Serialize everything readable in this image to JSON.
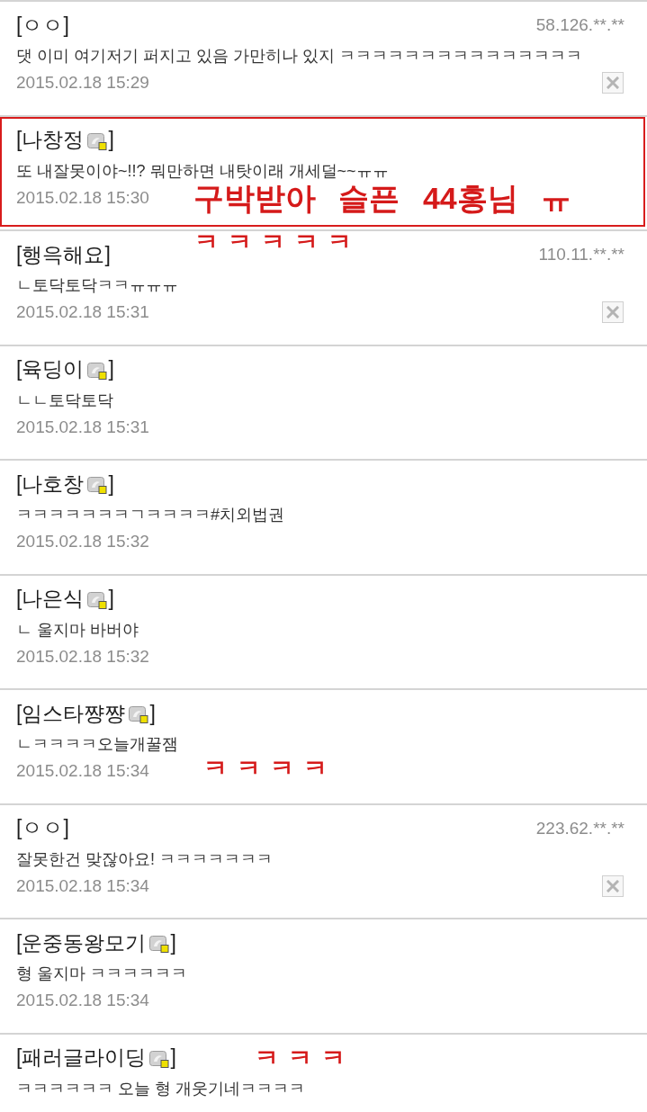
{
  "comments": [
    {
      "open": "[",
      "name": "ㅇㅇ",
      "close": "]",
      "member_icon": false,
      "ip": "58.126.**.**",
      "text": "댓 이미 여기저기 퍼지고 있음 가만히나 있지 ㅋㅋㅋㅋㅋㅋㅋㅋㅋㅋㅋㅋㅋㅋㅋ",
      "date": "2015.02.18 15:29",
      "deletable": true,
      "highlighted": false
    },
    {
      "open": "[",
      "name": "나창정",
      "close": "]",
      "member_icon": true,
      "text": "또 내잘못이야~!!? 뭐만하면 내탓이래 개세덜~~ㅠㅠ",
      "date": "2015.02.18 15:30",
      "deletable": false,
      "highlighted": true
    },
    {
      "open": "[",
      "name": "행윽해요",
      "close": "]",
      "member_icon": false,
      "ip": "110.11.**.**",
      "text": "ㄴ토닥토닥ㅋㅋㅠㅠㅠ",
      "date": "2015.02.18 15:31",
      "deletable": true,
      "highlighted": false
    },
    {
      "open": "[",
      "name": "육딩이",
      "close": "]",
      "member_icon": true,
      "text": "ㄴㄴ토닥토닥",
      "date": "2015.02.18 15:31",
      "deletable": false,
      "highlighted": false
    },
    {
      "open": "[",
      "name": "나호창",
      "close": "]",
      "member_icon": true,
      "text": "ㅋㅋㅋㅋㅋㅋㅋㄱㅋㅋㅋㅋ#치외법권",
      "date": "2015.02.18 15:32",
      "deletable": false,
      "highlighted": false
    },
    {
      "open": "[",
      "name": "나은식",
      "close": "]",
      "member_icon": true,
      "text": "ㄴ 울지마 바버야",
      "date": "2015.02.18 15:32",
      "deletable": false,
      "highlighted": false
    },
    {
      "open": "[",
      "name": "임스타쨩쨩",
      "close": "]",
      "member_icon": true,
      "text": "ㄴㅋㅋㅋㅋ오늘개꿀잼",
      "date": "2015.02.18 15:34",
      "deletable": false,
      "highlighted": false
    },
    {
      "open": "[",
      "name": "ㅇㅇ",
      "close": "]",
      "member_icon": false,
      "ip": "223.62.**.**",
      "text": "잘못한건 맞잖아요! ㅋㅋㅋㅋㅋㅋㅋ",
      "date": "2015.02.18 15:34",
      "deletable": true,
      "highlighted": false
    },
    {
      "open": "[",
      "name": "운중동왕모기",
      "close": "]",
      "member_icon": true,
      "text": "형 울지마 ㅋㅋㅋㅋㅋㅋ",
      "date": "2015.02.18 15:34",
      "deletable": false,
      "highlighted": false
    },
    {
      "open": "[",
      "name": "패러글라이딩",
      "close": "]",
      "member_icon": true,
      "text": "ㅋㅋㅋㅋㅋㅋ 오늘 형 개웃기네ㅋㅋㅋㅋ",
      "deletable": false,
      "highlighted": false
    }
  ],
  "annotations": [
    "구박받아 슬픈 44홍님 ㅠ",
    "ㅋㅋㅋㅋㅋ",
    "ㅋㅋㅋㅋ",
    "ㅋㅋㅋ"
  ]
}
